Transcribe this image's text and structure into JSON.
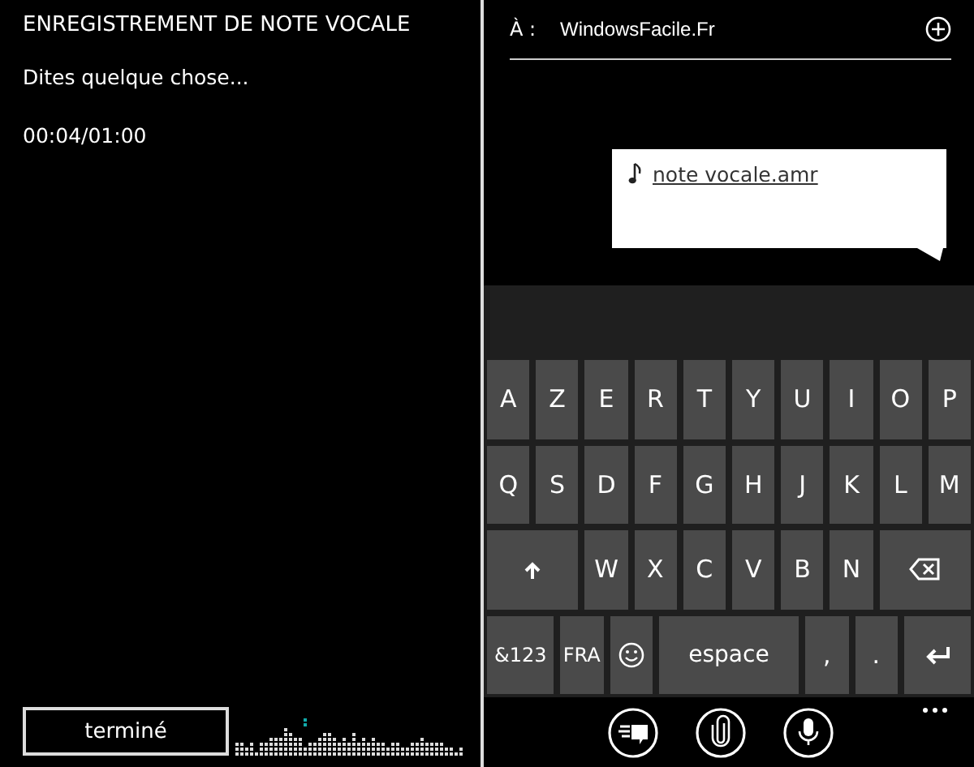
{
  "recorder": {
    "title": "ENREGISTREMENT DE NOTE VOCALE",
    "prompt": "Dites quelque chose...",
    "time": "00:04/01:00",
    "done_button": "terminé"
  },
  "message": {
    "to_label": "À :",
    "recipient": "WindowsFacile.Fr",
    "attachment": "note vocale.amr"
  },
  "keyboard": {
    "key_lines": [
      [
        {
          "kind": "char",
          "label": "A"
        },
        {
          "kind": "char",
          "label": "Z"
        },
        {
          "kind": "char",
          "label": "E"
        },
        {
          "kind": "char",
          "label": "R"
        },
        {
          "kind": "char",
          "label": "T"
        },
        {
          "kind": "char",
          "label": "Y"
        },
        {
          "kind": "char",
          "label": "U"
        },
        {
          "kind": "char",
          "label": "I"
        },
        {
          "kind": "char",
          "label": "O"
        },
        {
          "kind": "char",
          "label": "P"
        }
      ],
      [
        {
          "kind": "char",
          "label": "Q"
        },
        {
          "kind": "char",
          "label": "S"
        },
        {
          "kind": "char",
          "label": "D"
        },
        {
          "kind": "char",
          "label": "F"
        },
        {
          "kind": "char",
          "label": "G"
        },
        {
          "kind": "char",
          "label": "H"
        },
        {
          "kind": "char",
          "label": "J"
        },
        {
          "kind": "char",
          "label": "K"
        },
        {
          "kind": "char",
          "label": "L"
        },
        {
          "kind": "char",
          "label": "M"
        }
      ],
      [
        {
          "kind": "shift"
        },
        {
          "kind": "char",
          "label": "W"
        },
        {
          "kind": "char",
          "label": "X"
        },
        {
          "kind": "char",
          "label": "C"
        },
        {
          "kind": "char",
          "label": "V"
        },
        {
          "kind": "char",
          "label": "B"
        },
        {
          "kind": "char",
          "label": "N"
        },
        {
          "kind": "backspace"
        }
      ],
      [
        {
          "kind": "mode",
          "label": "&123"
        },
        {
          "kind": "lang",
          "label": "FRA"
        },
        {
          "kind": "emoji"
        },
        {
          "kind": "space",
          "label": "espace"
        },
        {
          "kind": "char",
          "label": ","
        },
        {
          "kind": "char",
          "label": "."
        },
        {
          "kind": "enter"
        }
      ]
    ]
  },
  "app_bar": [
    {
      "kind": "send"
    },
    {
      "kind": "attach"
    },
    {
      "kind": "mic"
    }
  ]
}
